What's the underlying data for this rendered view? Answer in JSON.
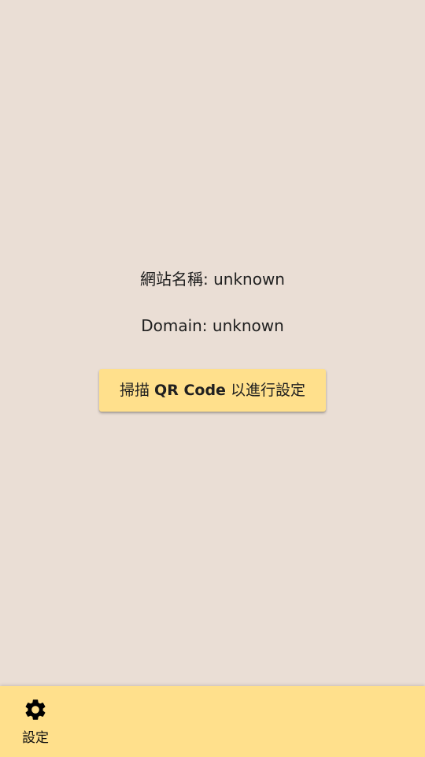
{
  "info": {
    "site_name_label": "網站名稱: unknown",
    "domain_label": "Domain: unknown"
  },
  "scan_button": {
    "prefix": "掃描 ",
    "bold": "QR Code",
    "suffix": " 以進行設定"
  },
  "bottom_nav": {
    "items": [
      {
        "label": "設定",
        "icon": "gear-icon"
      }
    ]
  },
  "colors": {
    "background": "#EADED5",
    "accent": "#FFE08C",
    "text": "#202020"
  }
}
